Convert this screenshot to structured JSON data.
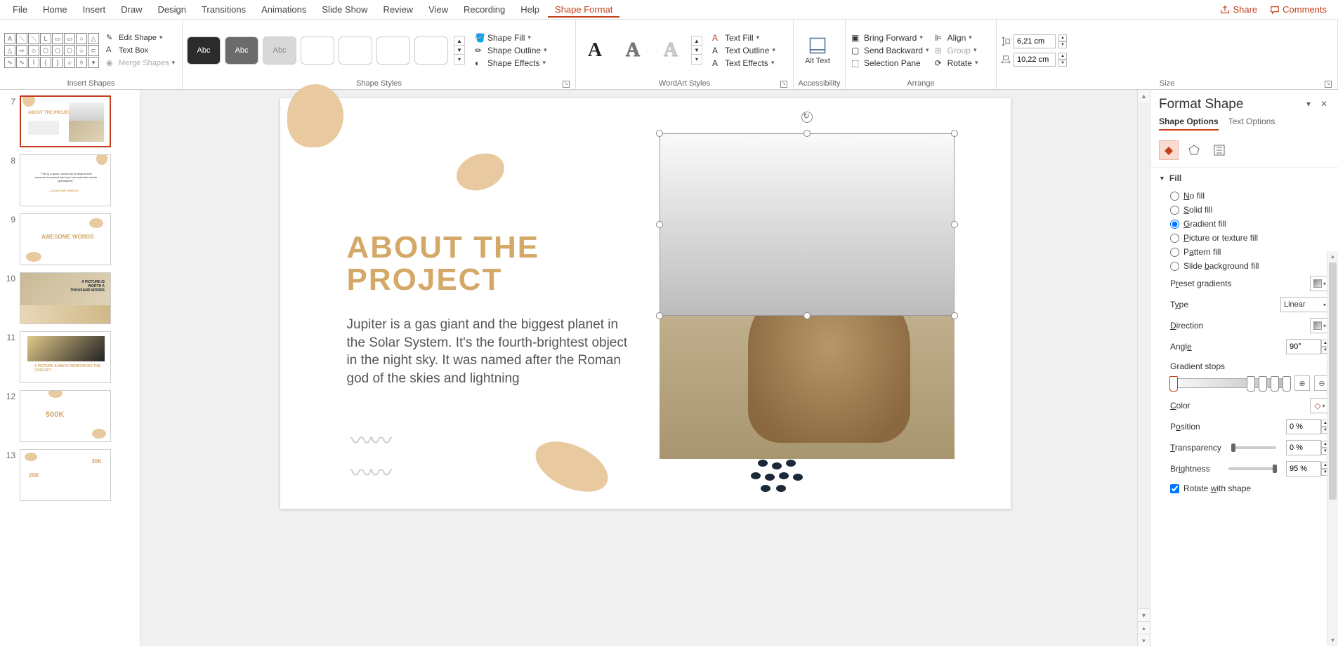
{
  "menubar": {
    "tabs": [
      "File",
      "Home",
      "Insert",
      "Draw",
      "Design",
      "Transitions",
      "Animations",
      "Slide Show",
      "Review",
      "View",
      "Recording",
      "Help",
      "Shape Format"
    ],
    "active_index": 12,
    "share": "Share",
    "comments": "Comments"
  },
  "ribbon": {
    "groups": {
      "insert_shapes": {
        "label": "Insert Shapes",
        "edit_shape": "Edit Shape",
        "text_box": "Text Box",
        "merge_shapes": "Merge Shapes"
      },
      "shape_styles": {
        "label": "Shape Styles",
        "swatch_text": "Abc",
        "shape_fill": "Shape Fill",
        "shape_outline": "Shape Outline",
        "shape_effects": "Shape Effects"
      },
      "wordart": {
        "label": "WordArt Styles",
        "glyph": "A",
        "text_fill": "Text Fill",
        "text_outline": "Text Outline",
        "text_effects": "Text Effects"
      },
      "accessibility": {
        "label": "Accessibility",
        "alt_text": "Alt Text"
      },
      "arrange": {
        "label": "Arrange",
        "bring_forward": "Bring Forward",
        "send_backward": "Send Backward",
        "selection_pane": "Selection Pane",
        "align": "Align",
        "group": "Group",
        "rotate": "Rotate"
      },
      "size": {
        "label": "Size",
        "height": "6,21 cm",
        "width": "10,22 cm"
      }
    }
  },
  "thumbnails": [
    {
      "num": 7,
      "selected": true,
      "title": "ABOUT THE PROJECT"
    },
    {
      "num": 8,
      "selected": false,
      "quote": "\"This is a quote, words full of wisdom that someone important said and can make the reader get inspired.\"",
      "author": "—SOMEONE FAMOUS"
    },
    {
      "num": 9,
      "selected": false,
      "title": "AWESOME WORDS"
    },
    {
      "num": 10,
      "selected": false,
      "title": "A PICTURE IS WORTH A THOUSAND WORDS"
    },
    {
      "num": 11,
      "selected": false,
      "title": "A PICTURE ALWAYS REINFORCES THE CONCEPT"
    },
    {
      "num": 12,
      "selected": false,
      "title": "500K"
    },
    {
      "num": 13,
      "selected": false,
      "title": "30K",
      "sub": "20K"
    }
  ],
  "slide": {
    "title_line1": "ABOUT THE",
    "title_line2": "PROJECT",
    "body": "Jupiter is a gas giant and the biggest planet in the Solar System. It's the fourth-brightest object in the night sky. It was named after the Roman god of the skies and lightning"
  },
  "pane": {
    "title": "Format Shape",
    "tab_shape": "Shape Options",
    "tab_text": "Text Options",
    "section_fill": "Fill",
    "fill_options": {
      "no_fill": "No fill",
      "solid_fill": "Solid fill",
      "gradient_fill": "Gradient fill",
      "picture_fill": "Picture or texture fill",
      "pattern_fill": "Pattern fill",
      "slide_bg_fill": "Slide background fill"
    },
    "preset_gradients": "Preset gradients",
    "type": "Type",
    "type_value": "Linear",
    "direction": "Direction",
    "angle": "Angle",
    "angle_value": "90°",
    "gradient_stops": "Gradient stops",
    "color": "Color",
    "position": "Position",
    "position_value": "0 %",
    "transparency": "Transparency",
    "transparency_value": "0 %",
    "brightness": "Brightness",
    "brightness_value": "95 %",
    "rotate_with_shape": "Rotate with shape"
  }
}
